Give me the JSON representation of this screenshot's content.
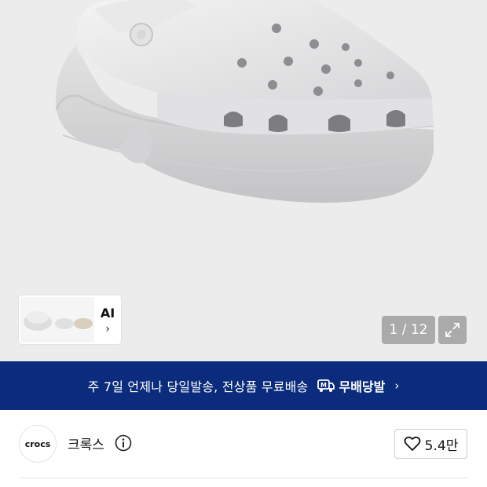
{
  "hero": {
    "image_alt": "Crocs white platform clog",
    "thumbnail": {
      "label": "AI",
      "chevron": "›"
    },
    "counter": "1 / 12",
    "expand_icon": "expand-arrows-icon"
  },
  "banner": {
    "text": "주 7일 언제나 당일발송, 전상품 무료배송",
    "brand": "무배당발",
    "logo_icon": "delivery-truck-icon",
    "chevron": "›",
    "background": "#0b2b7c"
  },
  "store": {
    "logo_text": "crocs",
    "name": "크록스",
    "info_icon": "info-circle-icon",
    "like_icon": "heart-outline-icon",
    "like_count": "5.4만"
  }
}
